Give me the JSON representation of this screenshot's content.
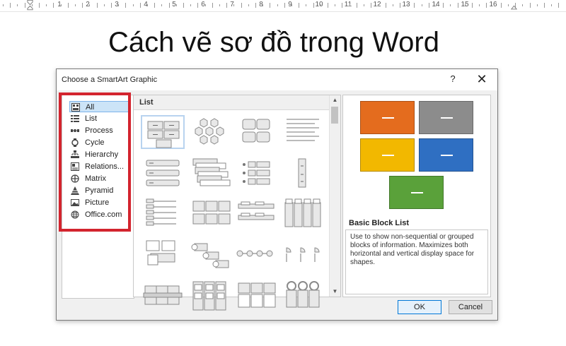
{
  "ruler": {
    "numbers": [
      "1",
      "2",
      "1",
      "2",
      "3",
      "4",
      "5",
      "6",
      "7",
      "8",
      "9",
      "10",
      "11",
      "12",
      "13",
      "14",
      "15",
      "16"
    ]
  },
  "page": {
    "title": "Cách vẽ sơ đồ trong Word"
  },
  "dialog": {
    "title": "Choose a SmartArt Graphic",
    "help_label": "?",
    "close_label": "✕",
    "categories": [
      {
        "label": "All",
        "icon": "all-icon"
      },
      {
        "label": "List",
        "icon": "list-icon"
      },
      {
        "label": "Process",
        "icon": "process-icon"
      },
      {
        "label": "Cycle",
        "icon": "cycle-icon"
      },
      {
        "label": "Hierarchy",
        "icon": "hierarchy-icon"
      },
      {
        "label": "Relations...",
        "icon": "relationship-icon"
      },
      {
        "label": "Matrix",
        "icon": "matrix-icon"
      },
      {
        "label": "Pyramid",
        "icon": "pyramid-icon"
      },
      {
        "label": "Picture",
        "icon": "picture-icon"
      },
      {
        "label": "Office.com",
        "icon": "globe-icon"
      }
    ],
    "selected_category": "All",
    "gallery_header": "List",
    "preview": {
      "name": "Basic Block List",
      "description": "Use to show non-sequential or grouped blocks of information. Maximizes both horizontal and vertical display space for shapes.",
      "block_colors": [
        "#e46c1e",
        "#8c8c8c",
        "#f2b800",
        "#2f6fc2",
        "#5aa13a"
      ]
    },
    "ok_label": "OK",
    "cancel_label": "Cancel"
  }
}
